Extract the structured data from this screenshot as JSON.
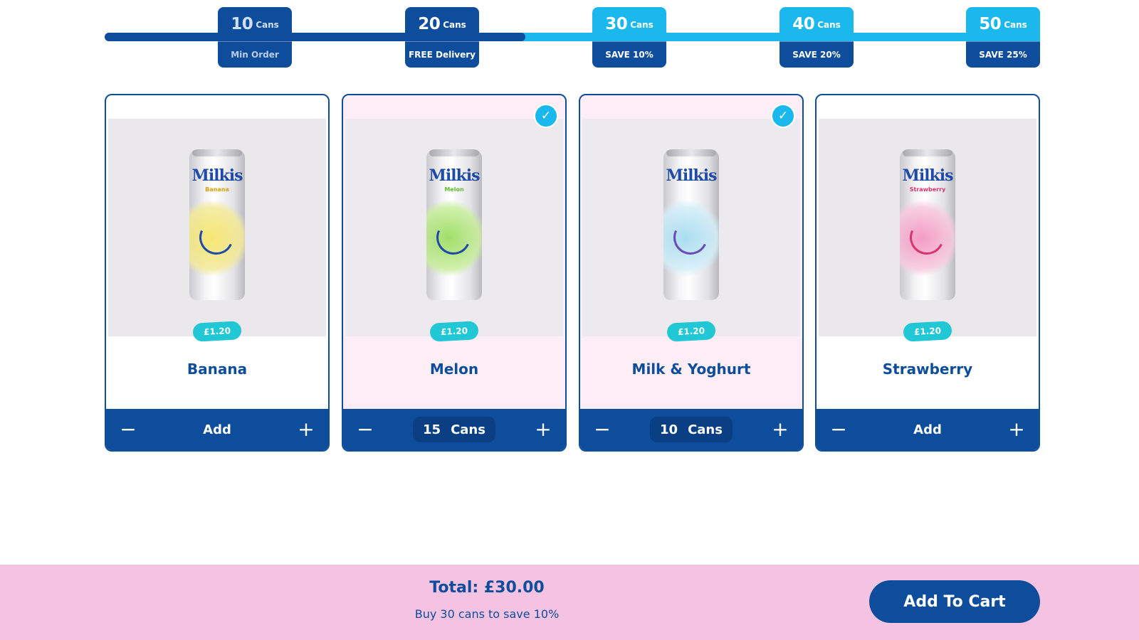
{
  "tiers": [
    {
      "cans": "10",
      "unit": "Cans",
      "reward": "Min Order"
    },
    {
      "cans": "20",
      "unit": "Cans",
      "reward": "FREE Delivery"
    },
    {
      "cans": "30",
      "unit": "Cans",
      "reward": "SAVE 10%"
    },
    {
      "cans": "40",
      "unit": "Cans",
      "reward": "SAVE 20%"
    },
    {
      "cans": "50",
      "unit": "Cans",
      "reward": "SAVE 25%"
    }
  ],
  "progress_fraction": 0.45,
  "colors": {
    "brand_blue": "#0e4c9c",
    "accent_cyan": "#1ab8ec",
    "price_teal": "#21c7d4",
    "footer_pink": "#f4c3e1",
    "selected_card": "#fdeef6"
  },
  "products": [
    {
      "name": "Banana",
      "price": "£1.20",
      "selected": false,
      "control_label": "Add",
      "quantity": null,
      "can_brand": "Milkis",
      "can_flavor": "Banana"
    },
    {
      "name": "Melon",
      "price": "£1.20",
      "selected": true,
      "control_label": null,
      "quantity": "15",
      "quantity_unit": "Cans",
      "can_brand": "Milkis",
      "can_flavor": "Melon"
    },
    {
      "name": "Milk & Yoghurt",
      "price": "£1.20",
      "selected": true,
      "control_label": null,
      "quantity": "10",
      "quantity_unit": "Cans",
      "can_brand": "Milkis",
      "can_flavor": ""
    },
    {
      "name": "Strawberry",
      "price": "£1.20",
      "selected": false,
      "control_label": "Add",
      "quantity": null,
      "can_brand": "Milkis",
      "can_flavor": "Strawberry"
    }
  ],
  "icons": {
    "minus": "minus-icon",
    "plus": "plus-icon",
    "check": "check-icon"
  },
  "footer": {
    "total": "Total: £30.00",
    "hint": "Buy 30 cans to save 10%",
    "cart_button": "Add To Cart"
  }
}
